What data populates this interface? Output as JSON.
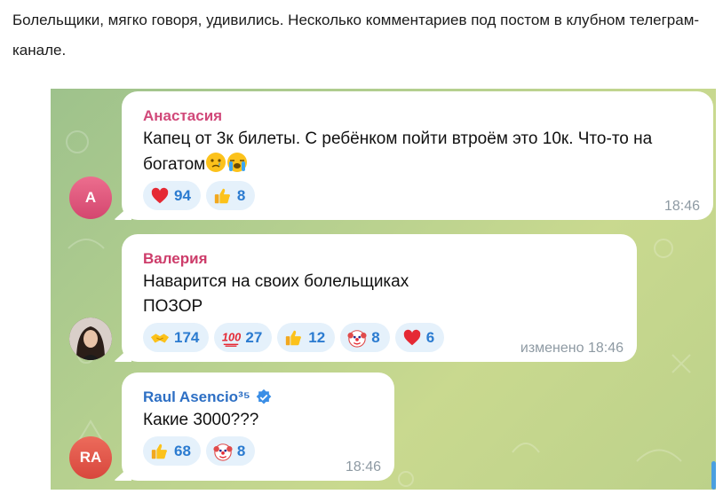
{
  "intro_text": "Болельщики, мягко говоря, удивились. Несколько комментариев под постом в клубном телеграм-канале.",
  "colors": {
    "accent": "#2b7bd0",
    "reaction_bg": "#e5f1fb",
    "name_anastasia": "#d1497a",
    "name_valeria": "#cd3c6a",
    "name_raul": "#2d6fc4"
  },
  "messages": [
    {
      "author": "Анастасия",
      "avatar_initials": "А",
      "text_line1": "Капец от 3к билеты. С ребёнком пойти втроём это 10к. Что-то на",
      "text_line2": "богатом",
      "inline_emojis": [
        "crying-face",
        "loudly-crying-face"
      ],
      "reactions": [
        {
          "icon": "red-heart",
          "count": "94"
        },
        {
          "icon": "thumbs-up",
          "count": "8"
        }
      ],
      "time": "18:46"
    },
    {
      "author": "Валерия",
      "avatar_initials": "",
      "text_line1": "Наварится на своих болельщиках",
      "text_line2": "ПОЗОР",
      "reactions": [
        {
          "icon": "handshake",
          "count": "174"
        },
        {
          "icon": "hundred-points",
          "count": "27"
        },
        {
          "icon": "thumbs-up",
          "count": "12"
        },
        {
          "icon": "clown-face",
          "count": "8"
        },
        {
          "icon": "red-heart",
          "count": "6"
        }
      ],
      "time": "изменено 18:46"
    },
    {
      "author": "Raul Asencio³⁵",
      "avatar_initials": "RA",
      "verified": true,
      "text_line1": "Какие 3000???",
      "reactions": [
        {
          "icon": "thumbs-up",
          "count": "68"
        },
        {
          "icon": "clown-face",
          "count": "8"
        }
      ],
      "time": "18:46"
    }
  ]
}
